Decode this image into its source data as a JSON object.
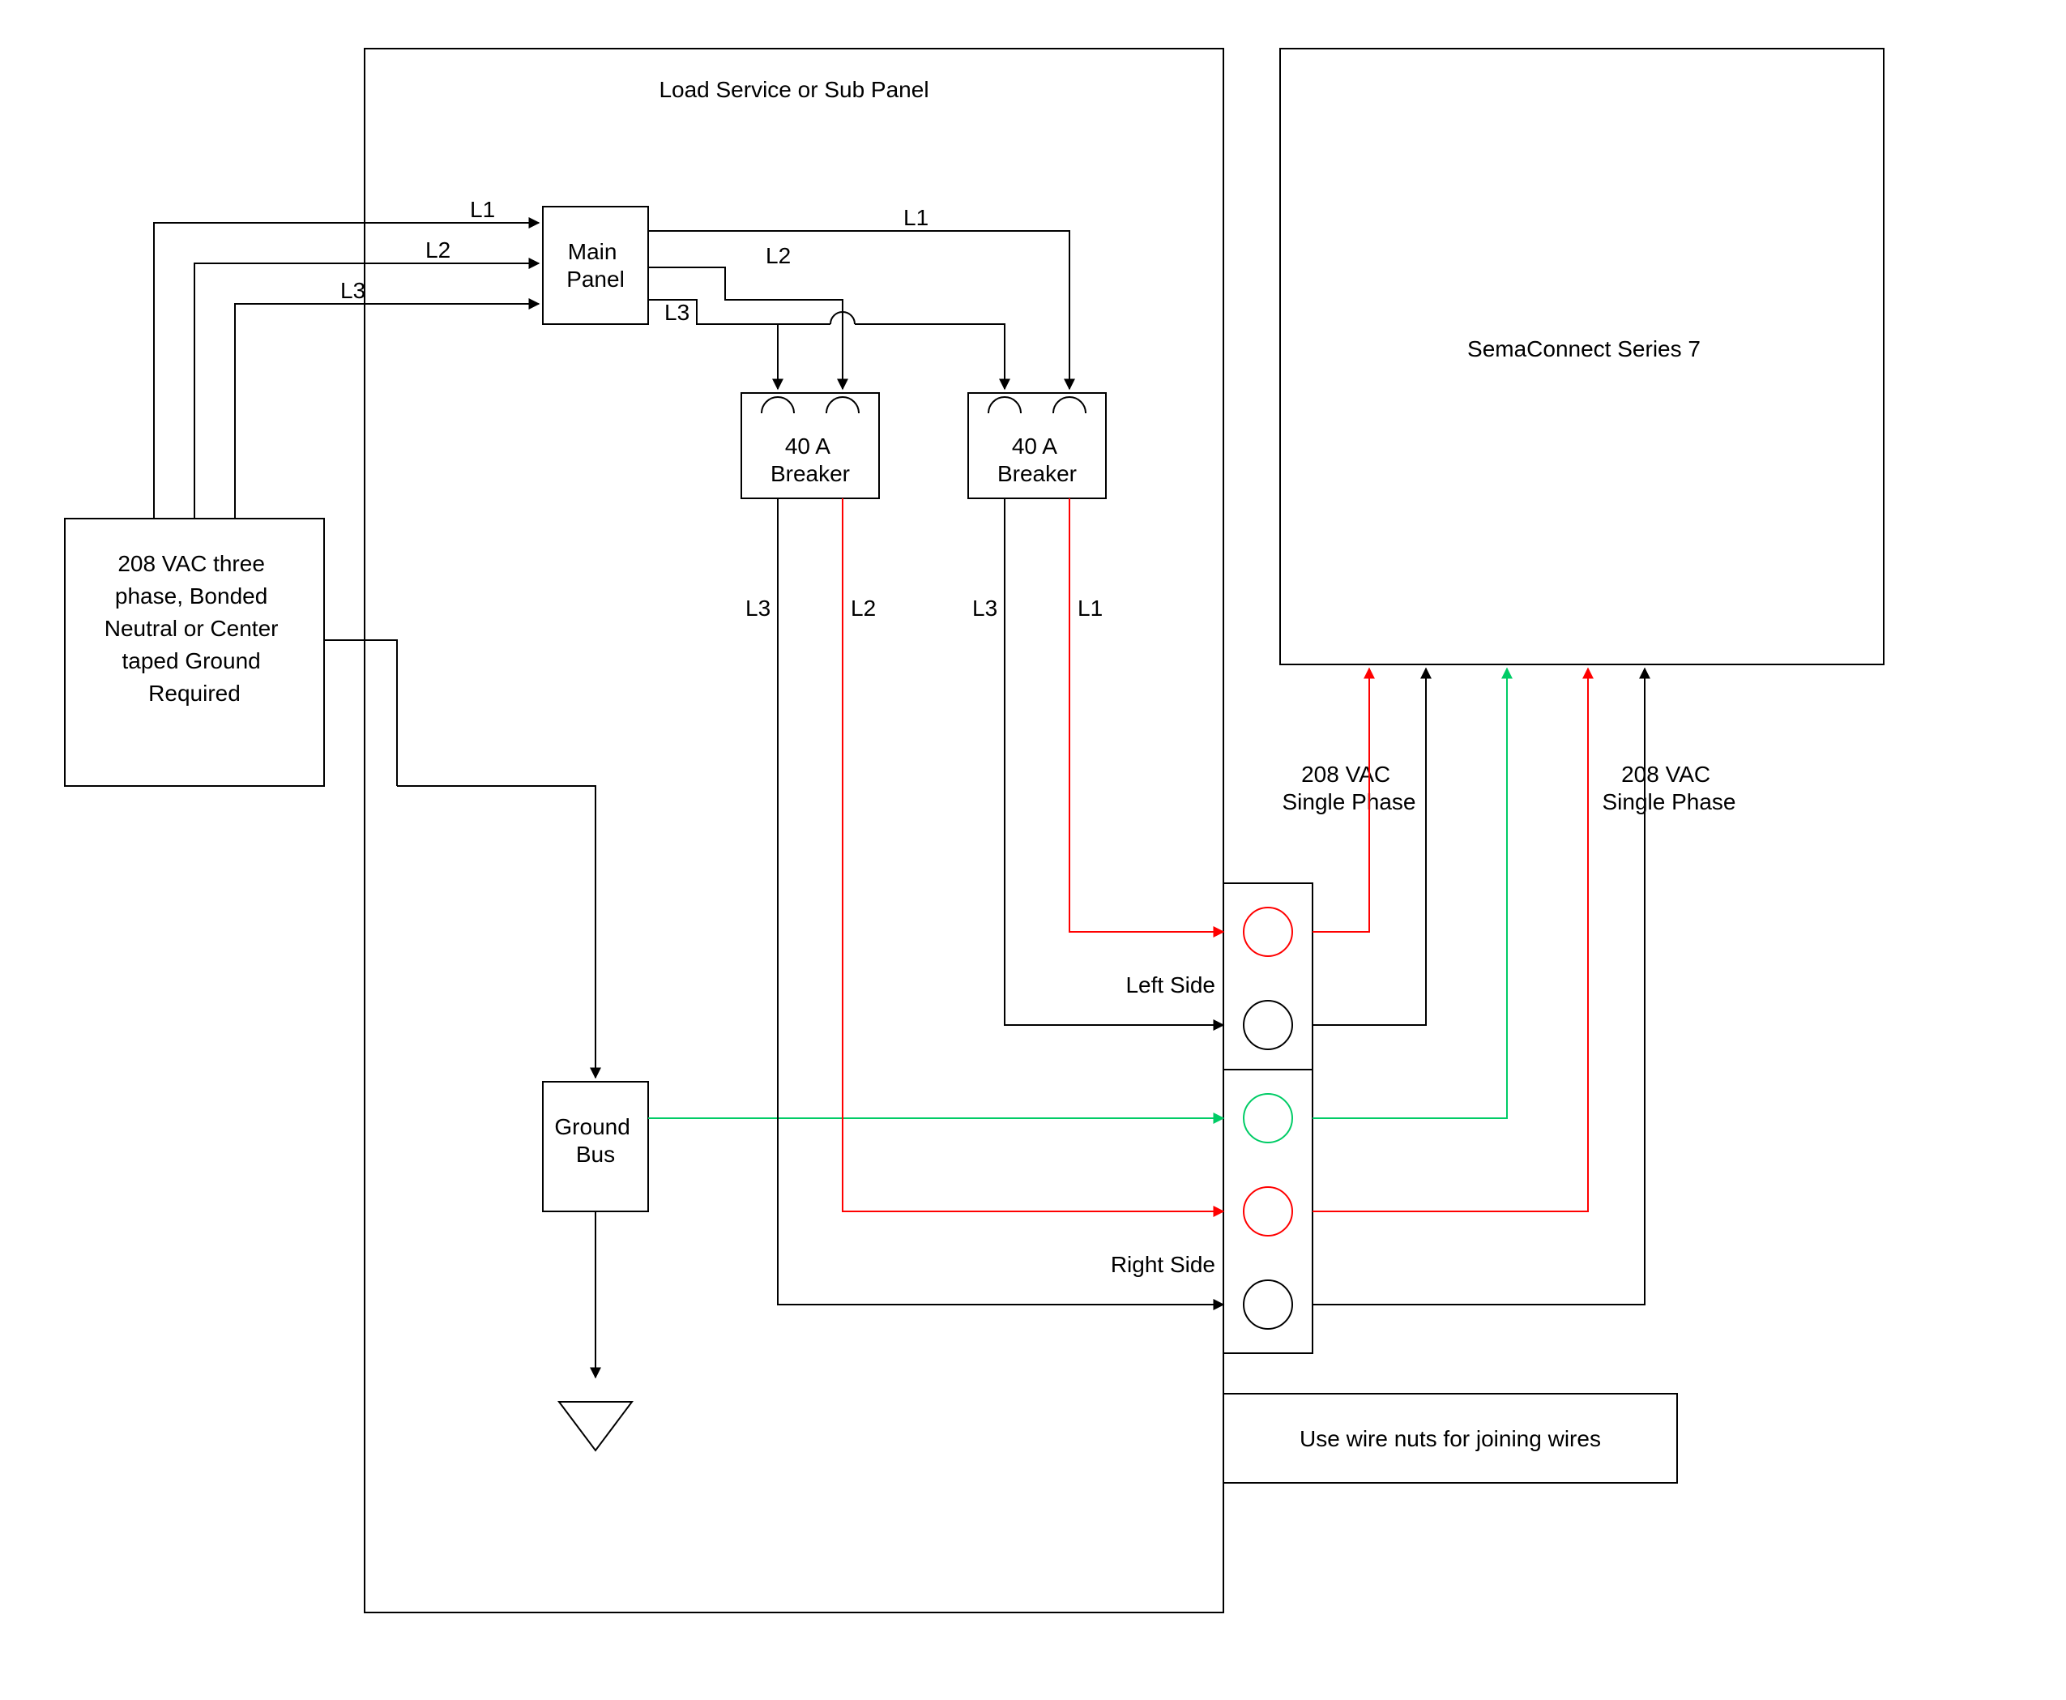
{
  "panel": {
    "title": "Load Service or Sub Panel",
    "main_panel": "Main Panel",
    "breaker1": "40 A Breaker",
    "breaker2": "40 A Breaker",
    "ground_bus": "Ground Bus",
    "left_side": "Left Side",
    "right_side": "Right Side"
  },
  "source": {
    "label": "208 VAC three phase, Bonded Neutral or Center taped Ground Required"
  },
  "lines": {
    "in_l1": "L1",
    "in_l2": "L2",
    "in_l3": "L3",
    "mp_l1": "L1",
    "mp_l2": "L2",
    "mp_l3": "L3",
    "b1_l3": "L3",
    "b1_l2": "L2",
    "b2_l3": "L3",
    "b2_l1": "L1"
  },
  "device": {
    "name": "SemaConnect Series 7",
    "phase1": "208 VAC Single Phase",
    "phase2": "208 VAC Single Phase",
    "note": "Use wire nuts for joining wires"
  },
  "colors": {
    "black": "#000000",
    "red": "#ff0000",
    "green": "#00cc66"
  }
}
